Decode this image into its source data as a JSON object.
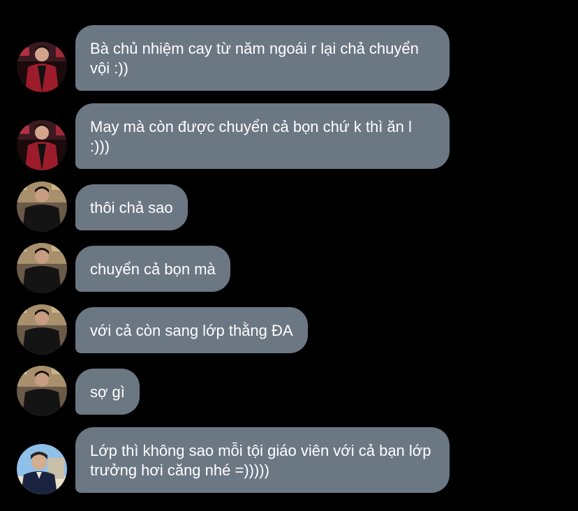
{
  "messages": [
    {
      "sender": "user-a",
      "text": "Bà chủ nhiệm cay từ năm ngoái r lại chả chuyển vội :))"
    },
    {
      "sender": "user-a",
      "text": "May mà còn được chuyển cả bọn chứ k thì ăn l :)))"
    },
    {
      "sender": "user-b",
      "text": "thôi chả sao"
    },
    {
      "sender": "user-b",
      "text": "chuyển cả bọn mà"
    },
    {
      "sender": "user-b",
      "text": "với cả còn sang lớp thằng ĐA"
    },
    {
      "sender": "user-b",
      "text": "sợ gì"
    },
    {
      "sender": "user-c",
      "text": "Lớp thì không sao mỗi tội giáo viên với cả bạn lớp trưởng hơi căng nhé =)))))"
    }
  ],
  "colors": {
    "background": "#000000",
    "bubble": "#6c7784",
    "bubble_text": "#ffffff"
  }
}
